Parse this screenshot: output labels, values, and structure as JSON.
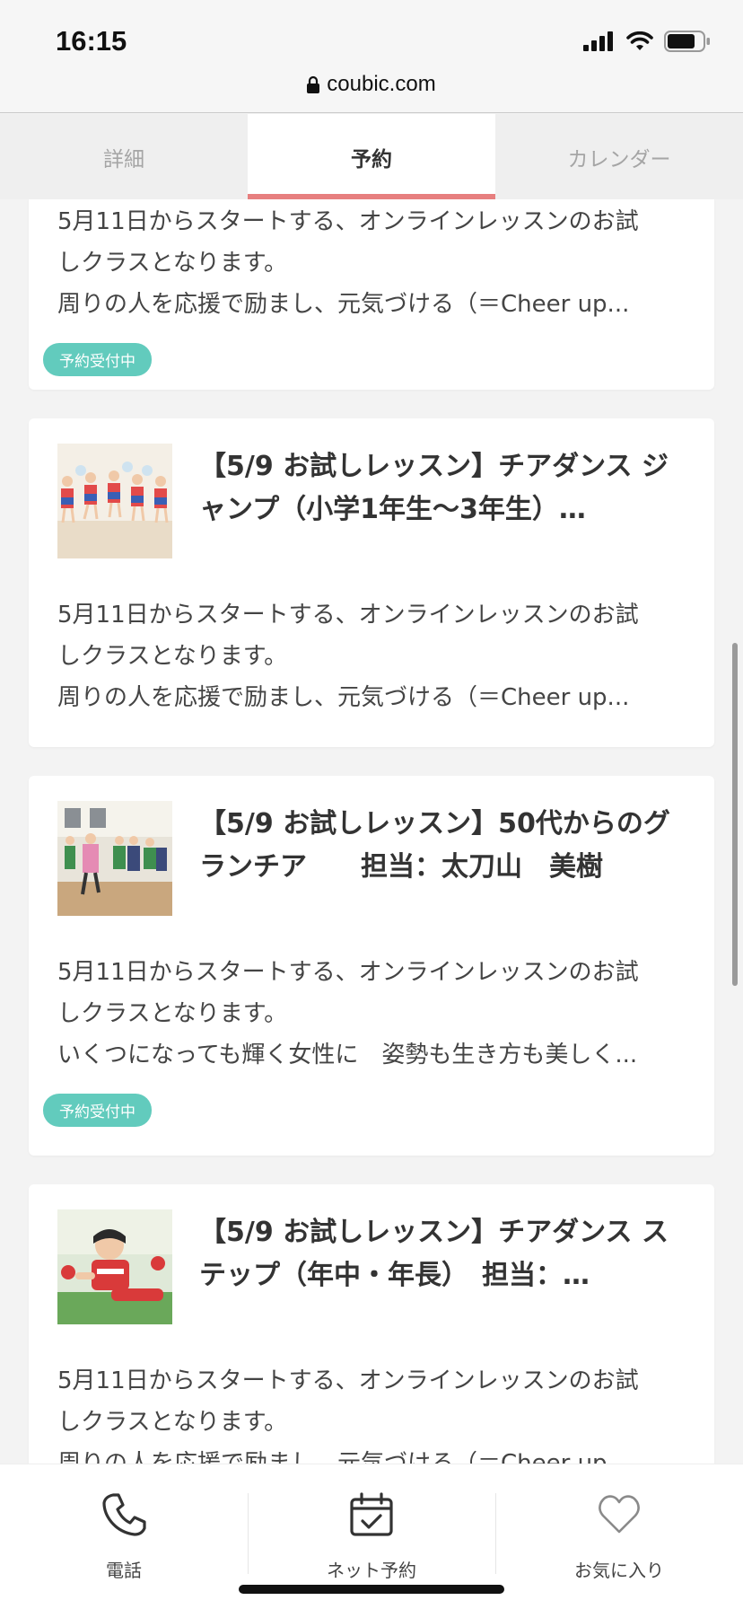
{
  "status_bar": {
    "time": "16:15",
    "url": "coubic.com"
  },
  "tabs": [
    {
      "label": "詳細",
      "active": false
    },
    {
      "label": "予約",
      "active": true
    },
    {
      "label": "カレンダー",
      "active": false
    }
  ],
  "cards": [
    {
      "title": "",
      "desc": [
        "5月11日からスタートする、オンラインレッスンのお試",
        "しクラスとなります。",
        "周りの人を応援で励まし、元気づける（＝Cheer up..."
      ],
      "badge": "予約受付中"
    },
    {
      "title": "【5/9 お試しレッスン】チアダンス ジャンプ（小学1年生〜3年生）…",
      "desc": [
        "5月11日からスタートする、オンラインレッスンのお試",
        "しクラスとなります。",
        "周りの人を応援で励まし、元気づける（＝Cheer up..."
      ],
      "badge": ""
    },
    {
      "title": "【5/9 お試しレッスン】50代からのグランチア　　担当：太刀山　美樹",
      "desc": [
        "5月11日からスタートする、オンラインレッスンのお試",
        "しクラスとなります。",
        "いくつになっても輝く女性に　姿勢も生き方も美しく..."
      ],
      "badge": "予約受付中"
    },
    {
      "title": "【5/9 お試しレッスン】チアダンス ステップ（年中・年長）　担当：…",
      "desc": [
        "5月11日からスタートする、オンラインレッスンのお試",
        "しクラスとなります。",
        "周りの人を応援で励まし、元気づける（＝Cheer up..."
      ],
      "badge": ""
    }
  ],
  "bottom_nav": [
    {
      "label": "電話",
      "icon": "phone-icon"
    },
    {
      "label": "ネット予約",
      "icon": "calendar-check-icon"
    },
    {
      "label": "お気に入り",
      "icon": "heart-icon"
    }
  ],
  "colors": {
    "accent": "#e77f7f",
    "badge": "#62cbbd"
  }
}
